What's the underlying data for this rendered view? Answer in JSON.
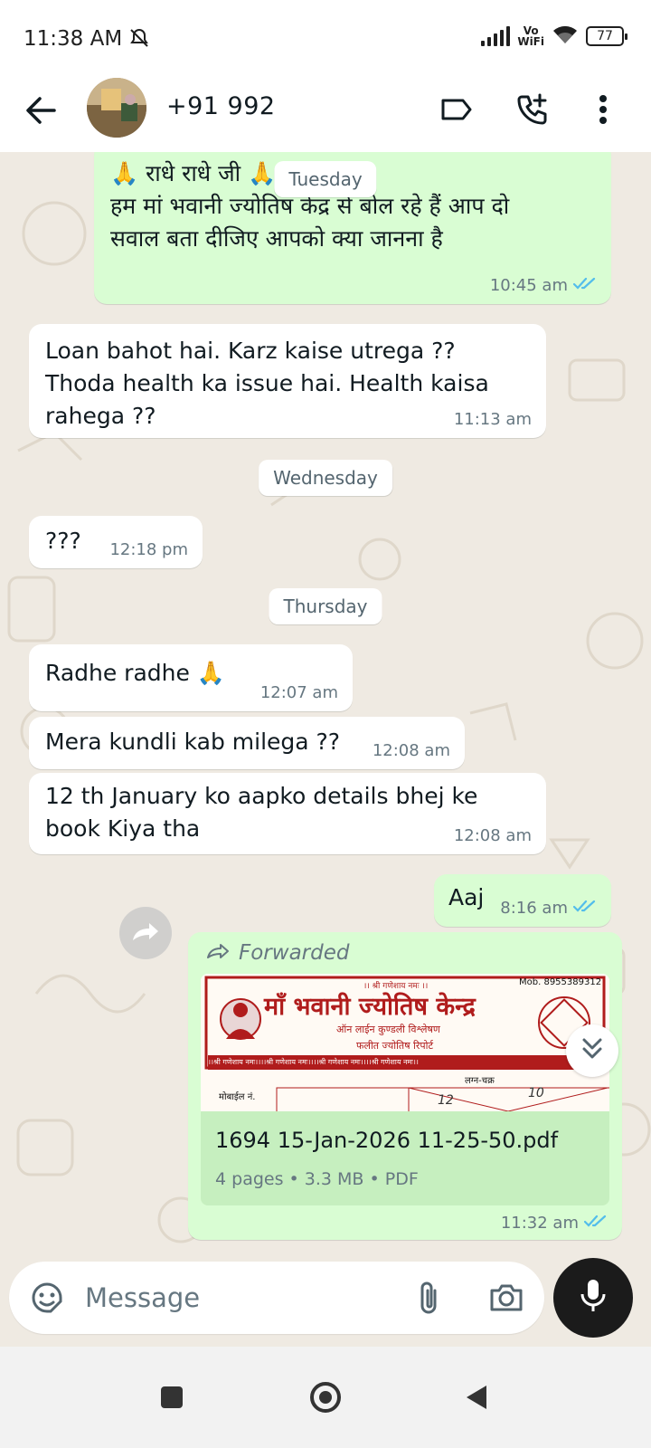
{
  "status_bar": {
    "time": "11:38 AM",
    "vowifi_line1": "Vo",
    "vowifi_line2": "WiFi",
    "battery": "77"
  },
  "header": {
    "contact_name": "+91 992"
  },
  "messages": [
    {
      "direction": "out",
      "text_line1": "🙏 राधे राधे जी 🙏",
      "text_line2": "हम मां भवानी ज्योतिष केंद्र से बोल रहे हैं आप दो",
      "text_line3": "सवाल बता दीजिए आपको क्या जानना है",
      "time": "10:45 am",
      "ticks": "read"
    },
    {
      "direction": "in",
      "text": "Loan bahot hai. Karz kaise utrega ??\nThoda health ka issue hai. Health kaisa\nrahega ??",
      "time": "11:13 am"
    },
    {
      "direction": "in",
      "text": "???",
      "time": "12:18 pm"
    },
    {
      "direction": "in",
      "text": "Radhe radhe 🙏",
      "time": "12:07 am"
    },
    {
      "direction": "in",
      "text": "Mera kundli kab milega ??",
      "time": "12:08 am"
    },
    {
      "direction": "in",
      "text": "12 th January ko aapko details bhej ke\nbook Kiya tha",
      "time": "12:08 am"
    },
    {
      "direction": "out",
      "text": "Aaj",
      "time": "8:16 am",
      "ticks": "read"
    }
  ],
  "date_chips": {
    "tuesday": "Tuesday",
    "wednesday": "Wednesday",
    "thursday": "Thursday"
  },
  "forwarded_doc": {
    "label": "Forwarded",
    "preview": {
      "top_text": "।। श्री गणेशाय नमः ।।",
      "mob": "Mob. 8955389312",
      "title": "माँ भवानी ज्योतिष केन्द्र",
      "subtitle1": "ऑन लाईन कुण्डली विश्लेषण",
      "subtitle2": "फलीत ज्योतिष रिपोर्ट",
      "banner": "।।श्री गणेशाय नमः।।।।श्री गणेशाय नमः।।।।श्री गणेशाय नमः।।।।श्री गणेशाय नमः।।",
      "mobile_label": "मोबाईल नं.",
      "lagna": "लग्न-चक्र",
      "hand1": "12",
      "hand2": "10"
    },
    "file_name": "1694 15-Jan-2026 11-25-50.pdf",
    "meta": "4 pages • 3.3 MB • PDF",
    "time": "11:32 am"
  },
  "input": {
    "placeholder": "Message"
  },
  "icons": {
    "back": "arrow-left-icon",
    "label": "label-icon",
    "call": "add-call-icon",
    "menu": "more-vert-icon",
    "sticker": "sticker-icon",
    "attach": "paperclip-icon",
    "camera": "camera-icon",
    "mic": "mic-icon"
  },
  "colors": {
    "outgoing_bubble": "#d9fdd3",
    "incoming_bubble": "#ffffff",
    "chat_bg": "#efeae2",
    "read_ticks": "#53bdeb",
    "doc_red": "#b01c1c"
  }
}
